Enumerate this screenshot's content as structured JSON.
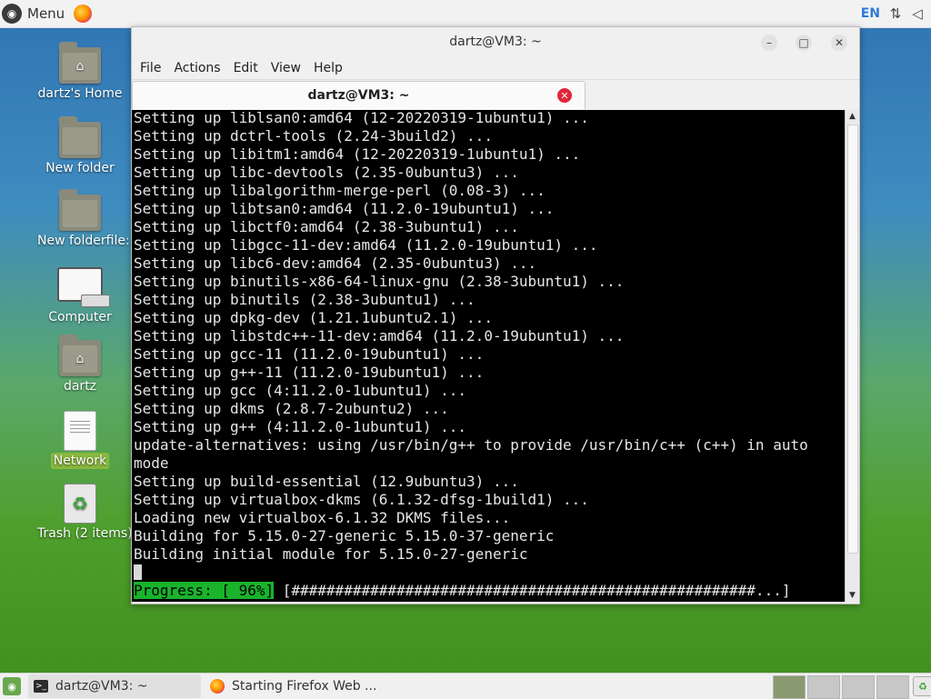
{
  "top_panel": {
    "menu_label": "Menu",
    "lang": "EN"
  },
  "desktop": {
    "icons": [
      {
        "label": "dartz's Home",
        "type": "home-folder"
      },
      {
        "label": "New folder",
        "type": "folder"
      },
      {
        "label": "New folderfile:",
        "type": "folder"
      },
      {
        "label": "Computer",
        "type": "computer"
      },
      {
        "label": "dartz",
        "type": "home-folder"
      },
      {
        "label": "Network",
        "type": "document",
        "selected": true
      },
      {
        "label": "Trash (2 items)",
        "type": "trash"
      }
    ]
  },
  "window": {
    "title": "dartz@VM3: ~",
    "menu": [
      "File",
      "Actions",
      "Edit",
      "View",
      "Help"
    ],
    "tab_title": "dartz@VM3: ~",
    "terminal_lines": [
      "Setting up liblsan0:amd64 (12-20220319-1ubuntu1) ...",
      "Setting up dctrl-tools (2.24-3build2) ...",
      "Setting up libitm1:amd64 (12-20220319-1ubuntu1) ...",
      "Setting up libc-devtools (2.35-0ubuntu3) ...",
      "Setting up libalgorithm-merge-perl (0.08-3) ...",
      "Setting up libtsan0:amd64 (11.2.0-19ubuntu1) ...",
      "Setting up libctf0:amd64 (2.38-3ubuntu1) ...",
      "Setting up libgcc-11-dev:amd64 (11.2.0-19ubuntu1) ...",
      "Setting up libc6-dev:amd64 (2.35-0ubuntu3) ...",
      "Setting up binutils-x86-64-linux-gnu (2.38-3ubuntu1) ...",
      "Setting up binutils (2.38-3ubuntu1) ...",
      "Setting up dpkg-dev (1.21.1ubuntu2.1) ...",
      "Setting up libstdc++-11-dev:amd64 (11.2.0-19ubuntu1) ...",
      "Setting up gcc-11 (11.2.0-19ubuntu1) ...",
      "Setting up g++-11 (11.2.0-19ubuntu1) ...",
      "Setting up gcc (4:11.2.0-1ubuntu1) ...",
      "Setting up dkms (2.8.7-2ubuntu2) ...",
      "Setting up g++ (4:11.2.0-1ubuntu1) ...",
      "update-alternatives: using /usr/bin/g++ to provide /usr/bin/c++ (c++) in auto",
      "mode",
      "Setting up build-essential (12.9ubuntu3) ...",
      "Setting up virtualbox-dkms (6.1.32-dfsg-1build1) ...",
      "Loading new virtualbox-6.1.32 DKMS files...",
      "Building for 5.15.0-27-generic 5.15.0-37-generic",
      "Building initial module for 5.15.0-27-generic"
    ],
    "progress_label": "Progress: [ 96%]",
    "progress_bar": " [#####################################################...]"
  },
  "bottom_panel": {
    "tasks": [
      {
        "label": "dartz@VM3: ~",
        "icon": "terminal-icon"
      },
      {
        "label": "Starting Firefox Web ...",
        "icon": "firefox-icon"
      }
    ]
  }
}
